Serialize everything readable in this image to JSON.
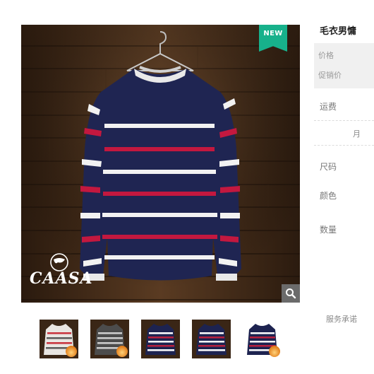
{
  "product": {
    "title": "毛衣男慵",
    "badge": "NEW",
    "brand": "CAASA"
  },
  "price_panel": {
    "price_label": "价格",
    "promo_label": "促销价"
  },
  "info": {
    "shipping_label": "运费",
    "month_fragment": "月",
    "size_label": "尺码",
    "color_label": "颜色",
    "quantity_label": "数量",
    "service_label": "服务承诺"
  },
  "icons": {
    "zoom": "magnifier-icon",
    "badge_color": "#17b18b"
  },
  "thumbnails": [
    {
      "name": "white-red-stripe",
      "body": "#e9e6e2",
      "stripe1": "#c8323c",
      "stripe2": "#5a5a5a",
      "flame": true
    },
    {
      "name": "gray-stripe",
      "body": "#4c4c4c",
      "stripe1": "#cfcfcf",
      "stripe2": "#cfcfcf",
      "flame": true
    },
    {
      "name": "navy-stripe",
      "body": "#1d2350",
      "stripe1": "#ffffff",
      "stripe2": "#b8203f",
      "flame": false
    },
    {
      "name": "navy-stripe-2",
      "body": "#1d2350",
      "stripe1": "#ffffff",
      "stripe2": "#b8203f",
      "flame": false
    },
    {
      "name": "navy-stripe-flame",
      "body": "#1d2350",
      "stripe1": "#ffffff",
      "stripe2": "#b8203f",
      "flame": true
    }
  ]
}
